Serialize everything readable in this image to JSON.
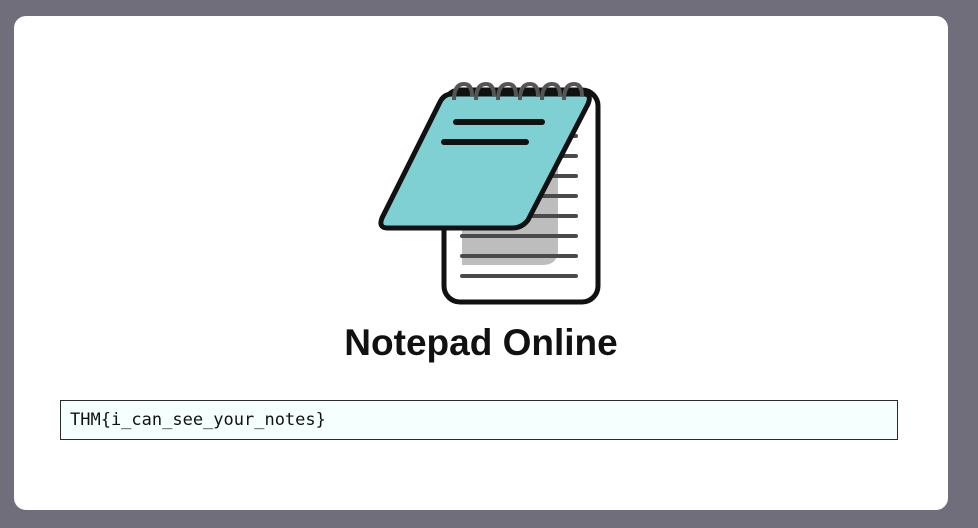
{
  "app": {
    "title": "Notepad Online",
    "logo_icon": "notepad-icon"
  },
  "note": {
    "content": "THM{i_can_see_your_notes}"
  },
  "colors": {
    "background": "#6f6e7a",
    "card": "#ffffff",
    "notepad_cover": "#7fd0d2",
    "note_field_bg": "#f4fffe"
  }
}
